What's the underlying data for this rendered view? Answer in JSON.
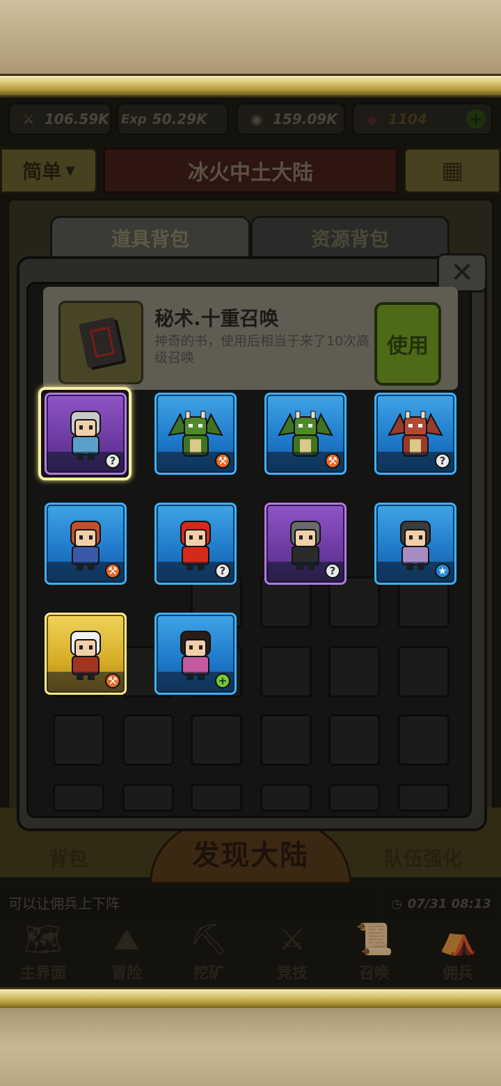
{
  "resources": {
    "attack": "106.59K",
    "exp_label": "Exp",
    "exp": "50.29K",
    "gold": "159.09K",
    "gems": "1104"
  },
  "header": {
    "difficulty": "简单",
    "region": "冰火中土大陆"
  },
  "tabs": {
    "items": "道具背包",
    "resources": "资源背包"
  },
  "detail": {
    "name": "秘术.十重召唤",
    "desc": "神奇的书，使用后相当于来了10次高级召唤",
    "use_label": "使用"
  },
  "heroes": [
    {
      "rarity": "purple",
      "type": "white-hair-hero",
      "badge": "?"
    },
    {
      "rarity": "blue",
      "type": "green-dragon",
      "badge": "wrench"
    },
    {
      "rarity": "blue",
      "type": "green-dragon",
      "badge": "wrench"
    },
    {
      "rarity": "blue",
      "type": "red-dragon",
      "badge": "?"
    },
    {
      "rarity": "blue",
      "type": "red-hair-warrior",
      "badge": "wrench"
    },
    {
      "rarity": "blue",
      "type": "red-hair-boy",
      "badge": "?"
    },
    {
      "rarity": "purple",
      "type": "gray-hair-man",
      "badge": "?"
    },
    {
      "rarity": "blue",
      "type": "spiky-hair-fighter",
      "badge": "star"
    },
    {
      "rarity": "gold",
      "type": "white-hair-swordsman",
      "badge": "wrench"
    },
    {
      "rarity": "blue",
      "type": "dark-hair-girl",
      "badge": "plus"
    }
  ],
  "bottom": {
    "backpack": "背包",
    "discover": "发现大陆",
    "team_boost": "队伍强化",
    "ticker": "可以让佣兵上下阵",
    "clock": "07/31 08:13"
  },
  "nav": [
    {
      "label": "主界面",
      "icon": "map-icon"
    },
    {
      "label": "冒险",
      "icon": "island-icon"
    },
    {
      "label": "挖矿",
      "icon": "pickaxe-icon"
    },
    {
      "label": "竞技",
      "icon": "swords-icon"
    },
    {
      "label": "召唤",
      "icon": "scroll-icon"
    },
    {
      "label": "佣兵",
      "icon": "tent-icon"
    }
  ],
  "colors": {
    "gold_bar": "#d9c874",
    "blue_card": "#1e78c8",
    "purple_card": "#6b3aa0",
    "gold_card": "#d6ad25"
  }
}
